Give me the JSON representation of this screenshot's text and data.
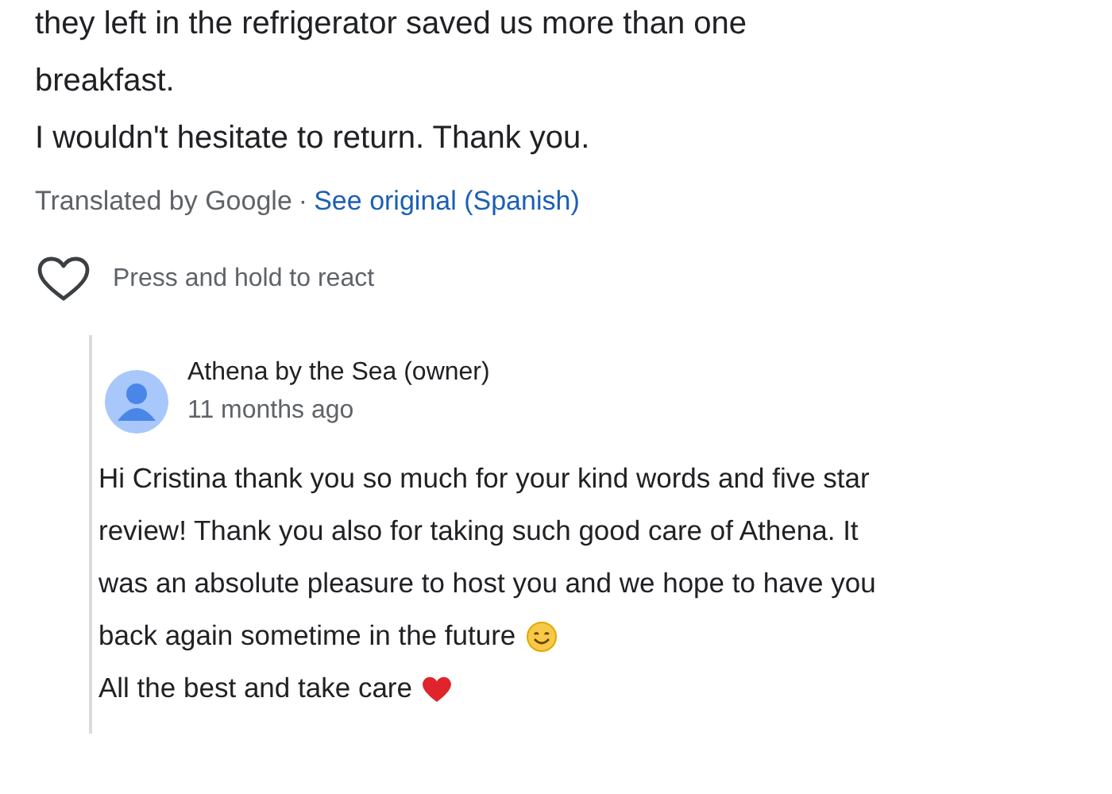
{
  "review": {
    "lines": [
      "they left in the refrigerator saved us more than one",
      "breakfast.",
      "I wouldn't hesitate to return. Thank you."
    ]
  },
  "translation": {
    "label": "Translated by Google",
    "separator": "·",
    "link": "See original (Spanish)"
  },
  "react": {
    "label": "Press and hold to react"
  },
  "reply": {
    "author": "Athena by the Sea (owner)",
    "time": "11 months ago",
    "lines": [
      {
        "text": "Hi Cristina thank you so much for your kind words and five star"
      },
      {
        "text": "review! Thank you also for taking such good care of Athena. It"
      },
      {
        "text": "was an absolute pleasure to host you and we hope to have you"
      },
      {
        "text": "back again sometime in the future",
        "kind": "smile"
      },
      {
        "text": "All the best and take care",
        "kind": "heart"
      }
    ]
  }
}
